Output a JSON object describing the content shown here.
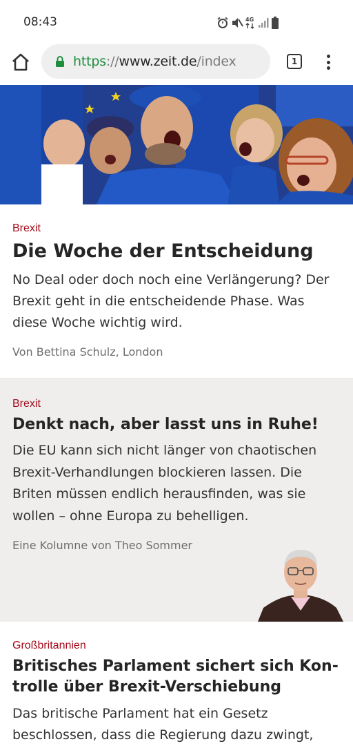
{
  "status_bar": {
    "time": "08:43",
    "icons": [
      "alarm-icon",
      "mute-icon",
      "4g-icon",
      "signal-icon",
      "battery-icon"
    ]
  },
  "browser": {
    "url_scheme": "https",
    "url_separator": "://",
    "url_host": "www.zeit.de",
    "url_path": "/index",
    "tab_count": "1",
    "secure_color": "#1e8e3e"
  },
  "articles": [
    {
      "kicker": "Brexit",
      "title": "Die Woche der Entscheidung",
      "teaser": "No Deal oder doch noch eine Verlängerung? Der Brexit geht in die entscheidende Phase. Was diese Woche wichtig wird.",
      "byline": "Von Bettina Schulz, London"
    },
    {
      "kicker": "Brexit",
      "title": "Denkt nach, aber lasst uns in Ruhe!",
      "teaser": "Die EU kann sich nicht länger von chaotischen Brexit-Verhandlungen blockieren lassen. Die Briten müssen endlich herausfinden, was sie wollen – ohne Europa zu behelligen.",
      "byline": "Eine Kolumne von Theo Sommer"
    },
    {
      "kicker": "Großbritannien",
      "title": "Britisches Parlament sichert sich Kon-trolle über Brexit-Verschiebung",
      "teaser": "Das britische Parlament hat ein Gesetz beschlossen, dass die Regierung dazu zwingt,"
    }
  ],
  "colors": {
    "kicker": "#a50a1a",
    "column_background": "#efeeed",
    "eu_blue": "#1d3f96"
  }
}
